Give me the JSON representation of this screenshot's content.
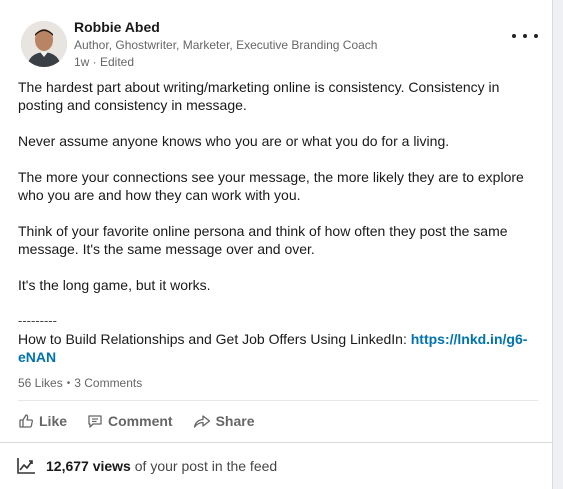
{
  "post": {
    "author_name": "Robbie Abed",
    "author_headline": "Author, Ghostwriter, Marketer, Executive Branding Coach",
    "timestamp": "1w · Edited",
    "paragraphs": [
      "The hardest part about writing/marketing online is consistency. Consistency in posting and consistency in message.",
      "Never assume anyone knows who you are or what you do for a living.",
      "The more your connections see your message, the more likely they are to explore who you are and how they can work with you.",
      "Think of your favorite online persona and think of how often they post the same message. It's the same message over and over.",
      "It's the long game, but it works."
    ],
    "separator": "---------",
    "promo_text": " How to Build Relationships and Get Job Offers Using LinkedIn: ",
    "promo_link": "https://lnkd.in/g6-eNAN"
  },
  "social": {
    "likes": "56 Likes",
    "dot": "•",
    "comments": "3 Comments"
  },
  "actions": {
    "like": "Like",
    "comment": "Comment",
    "share": "Share"
  },
  "views": {
    "count": "12,677 views",
    "text": "of your post in the feed"
  },
  "colors": {
    "link": "#0073b1",
    "muted": "#666666"
  }
}
